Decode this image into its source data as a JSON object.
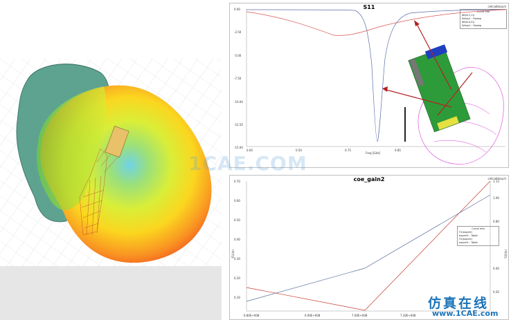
{
  "s11": {
    "title": "S11",
    "corner": "cellcalbtouch",
    "x_axis_label": "Freq [GHz]",
    "y_ticks": [
      "0.00",
      "-2.50",
      "-5.00",
      "-7.50",
      "-10.00",
      "-12.50",
      "-15.00"
    ],
    "x_ticks": [
      "0.00",
      "0.50",
      "0.75",
      "0.85"
    ],
    "legend": {
      "title": "Curve Info",
      "rows": [
        "dB(S(1,1))",
        "Setup1 : Sweep",
        "dB(S(4,4))",
        "Setup1 : Sweep"
      ]
    }
  },
  "gain": {
    "title": "coe_gain2",
    "corner": "cellcalbtouch",
    "y_left_label": "Y1(lin)",
    "y_right_label": "Y2(lin)",
    "x_axis_label": "Freq",
    "y_left_ticks": [
      "0.70",
      "0.60",
      "0.50",
      "0.40",
      "0.30",
      "0.20",
      "0.10"
    ],
    "y_right_ticks": [
      "1.13",
      "1.00",
      "0.80",
      "0.60",
      "0.40",
      "0.20"
    ],
    "x_ticks": [
      "6.80E+008",
      "6.90E+008",
      "7.00E+008",
      "7.20E+008"
    ],
    "legend": {
      "title": "Curve Info",
      "rows": [
        "Y1(expert)",
        "expert1 : Table",
        "Y2(expert)",
        "expert1 : Table"
      ]
    }
  },
  "watermark": "1CAE.COM",
  "brand": {
    "name": "仿真在线",
    "url": "www.1CAE.com"
  },
  "colors": {
    "red_curve": "#d9534f",
    "blue_curve": "#5b6ea8",
    "arrow": "#b22222",
    "gain_red": "#c0392b",
    "gain_blue": "#566c9a"
  }
}
